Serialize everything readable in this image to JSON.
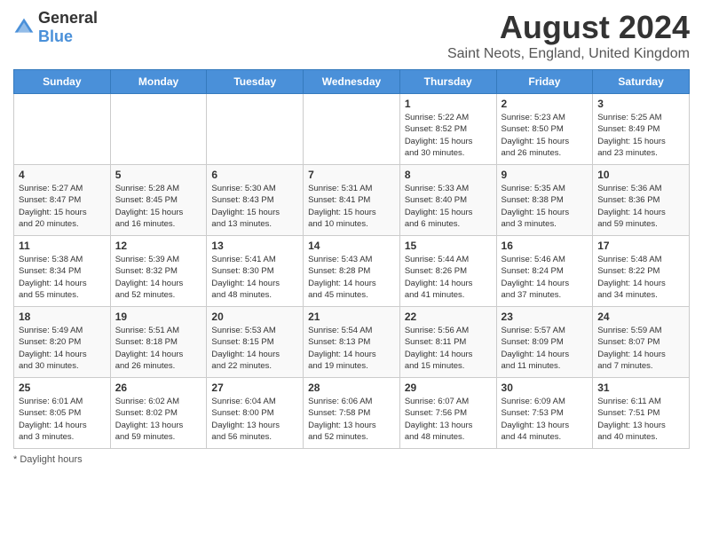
{
  "header": {
    "logo_general": "General",
    "logo_blue": "Blue",
    "month_year": "August 2024",
    "location": "Saint Neots, England, United Kingdom"
  },
  "days_of_week": [
    "Sunday",
    "Monday",
    "Tuesday",
    "Wednesday",
    "Thursday",
    "Friday",
    "Saturday"
  ],
  "footer": {
    "label": "Daylight hours"
  },
  "weeks": [
    [
      {
        "day": "",
        "info": ""
      },
      {
        "day": "",
        "info": ""
      },
      {
        "day": "",
        "info": ""
      },
      {
        "day": "",
        "info": ""
      },
      {
        "day": "1",
        "info": "Sunrise: 5:22 AM\nSunset: 8:52 PM\nDaylight: 15 hours\nand 30 minutes."
      },
      {
        "day": "2",
        "info": "Sunrise: 5:23 AM\nSunset: 8:50 PM\nDaylight: 15 hours\nand 26 minutes."
      },
      {
        "day": "3",
        "info": "Sunrise: 5:25 AM\nSunset: 8:49 PM\nDaylight: 15 hours\nand 23 minutes."
      }
    ],
    [
      {
        "day": "4",
        "info": "Sunrise: 5:27 AM\nSunset: 8:47 PM\nDaylight: 15 hours\nand 20 minutes."
      },
      {
        "day": "5",
        "info": "Sunrise: 5:28 AM\nSunset: 8:45 PM\nDaylight: 15 hours\nand 16 minutes."
      },
      {
        "day": "6",
        "info": "Sunrise: 5:30 AM\nSunset: 8:43 PM\nDaylight: 15 hours\nand 13 minutes."
      },
      {
        "day": "7",
        "info": "Sunrise: 5:31 AM\nSunset: 8:41 PM\nDaylight: 15 hours\nand 10 minutes."
      },
      {
        "day": "8",
        "info": "Sunrise: 5:33 AM\nSunset: 8:40 PM\nDaylight: 15 hours\nand 6 minutes."
      },
      {
        "day": "9",
        "info": "Sunrise: 5:35 AM\nSunset: 8:38 PM\nDaylight: 15 hours\nand 3 minutes."
      },
      {
        "day": "10",
        "info": "Sunrise: 5:36 AM\nSunset: 8:36 PM\nDaylight: 14 hours\nand 59 minutes."
      }
    ],
    [
      {
        "day": "11",
        "info": "Sunrise: 5:38 AM\nSunset: 8:34 PM\nDaylight: 14 hours\nand 55 minutes."
      },
      {
        "day": "12",
        "info": "Sunrise: 5:39 AM\nSunset: 8:32 PM\nDaylight: 14 hours\nand 52 minutes."
      },
      {
        "day": "13",
        "info": "Sunrise: 5:41 AM\nSunset: 8:30 PM\nDaylight: 14 hours\nand 48 minutes."
      },
      {
        "day": "14",
        "info": "Sunrise: 5:43 AM\nSunset: 8:28 PM\nDaylight: 14 hours\nand 45 minutes."
      },
      {
        "day": "15",
        "info": "Sunrise: 5:44 AM\nSunset: 8:26 PM\nDaylight: 14 hours\nand 41 minutes."
      },
      {
        "day": "16",
        "info": "Sunrise: 5:46 AM\nSunset: 8:24 PM\nDaylight: 14 hours\nand 37 minutes."
      },
      {
        "day": "17",
        "info": "Sunrise: 5:48 AM\nSunset: 8:22 PM\nDaylight: 14 hours\nand 34 minutes."
      }
    ],
    [
      {
        "day": "18",
        "info": "Sunrise: 5:49 AM\nSunset: 8:20 PM\nDaylight: 14 hours\nand 30 minutes."
      },
      {
        "day": "19",
        "info": "Sunrise: 5:51 AM\nSunset: 8:18 PM\nDaylight: 14 hours\nand 26 minutes."
      },
      {
        "day": "20",
        "info": "Sunrise: 5:53 AM\nSunset: 8:15 PM\nDaylight: 14 hours\nand 22 minutes."
      },
      {
        "day": "21",
        "info": "Sunrise: 5:54 AM\nSunset: 8:13 PM\nDaylight: 14 hours\nand 19 minutes."
      },
      {
        "day": "22",
        "info": "Sunrise: 5:56 AM\nSunset: 8:11 PM\nDaylight: 14 hours\nand 15 minutes."
      },
      {
        "day": "23",
        "info": "Sunrise: 5:57 AM\nSunset: 8:09 PM\nDaylight: 14 hours\nand 11 minutes."
      },
      {
        "day": "24",
        "info": "Sunrise: 5:59 AM\nSunset: 8:07 PM\nDaylight: 14 hours\nand 7 minutes."
      }
    ],
    [
      {
        "day": "25",
        "info": "Sunrise: 6:01 AM\nSunset: 8:05 PM\nDaylight: 14 hours\nand 3 minutes."
      },
      {
        "day": "26",
        "info": "Sunrise: 6:02 AM\nSunset: 8:02 PM\nDaylight: 13 hours\nand 59 minutes."
      },
      {
        "day": "27",
        "info": "Sunrise: 6:04 AM\nSunset: 8:00 PM\nDaylight: 13 hours\nand 56 minutes."
      },
      {
        "day": "28",
        "info": "Sunrise: 6:06 AM\nSunset: 7:58 PM\nDaylight: 13 hours\nand 52 minutes."
      },
      {
        "day": "29",
        "info": "Sunrise: 6:07 AM\nSunset: 7:56 PM\nDaylight: 13 hours\nand 48 minutes."
      },
      {
        "day": "30",
        "info": "Sunrise: 6:09 AM\nSunset: 7:53 PM\nDaylight: 13 hours\nand 44 minutes."
      },
      {
        "day": "31",
        "info": "Sunrise: 6:11 AM\nSunset: 7:51 PM\nDaylight: 13 hours\nand 40 minutes."
      }
    ]
  ]
}
